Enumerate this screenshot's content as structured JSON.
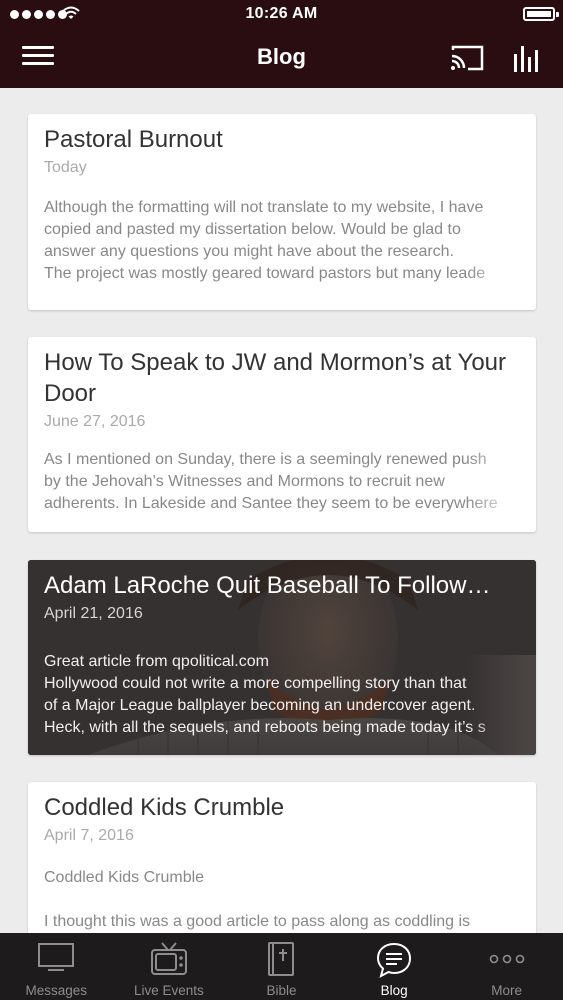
{
  "status_bar": {
    "time": "10:26 AM"
  },
  "nav": {
    "title": "Blog"
  },
  "posts": [
    {
      "title": "Pastoral Burnout",
      "date": "Today",
      "excerpt": "Although the formatting will not translate to my website, I have\ncopied and pasted my dissertation below. Would be glad to\nanswer any questions you might have about the research.\nThe project was mostly geared toward pastors but many leade"
    },
    {
      "title": "How To Speak to JW and Mormon’s at Your Door",
      "date": "June 27, 2016",
      "excerpt": "As I mentioned on Sunday, there is a seemingly renewed push\nby the Jehovah’s Witnesses and Mormons to recruit new\nadherents. In Lakeside and Santee they seem to be everywhere"
    },
    {
      "title": "Adam LaRoche Quit Baseball To Follow…",
      "date": "April 21, 2016",
      "excerpt": "Great article from qpolitical.com\nHollywood could not write a more compelling story than that\nof a Major League ballplayer becoming an undercover agent.\nHeck, with all the sequels, and reboots being made today it’s s"
    },
    {
      "title": "Coddled Kids Crumble",
      "date": "April 7, 2016",
      "excerpt": "Coddled Kids Crumble\n\nI thought this was a good article to pass along as coddling is"
    }
  ],
  "tabs": [
    {
      "label": "Messages",
      "icon": "monitor-icon"
    },
    {
      "label": "Live Events",
      "icon": "tv-icon"
    },
    {
      "label": "Bible",
      "icon": "bible-icon"
    },
    {
      "label": "Blog",
      "icon": "chat-bubble-icon",
      "active": true
    },
    {
      "label": "More",
      "icon": "more-icon"
    }
  ],
  "colors": {
    "header": "#2a0d10",
    "tabbar": "#1d1b1b",
    "background": "#ececec"
  }
}
